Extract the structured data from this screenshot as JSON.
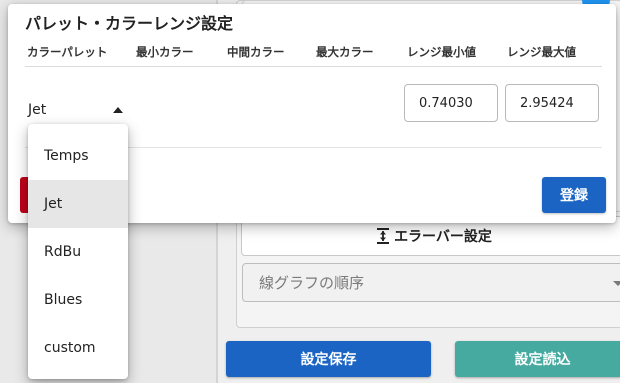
{
  "dialog": {
    "title": "パレット・カラーレンジ設定",
    "headers": [
      "カラーパレット",
      "最小カラー",
      "中間カラー",
      "最大カラー",
      "レンジ最小値",
      "レンジ最大値"
    ],
    "palette_value": "Jet",
    "range_min": "0.74030",
    "range_max": "2.95424",
    "register_label": "登録"
  },
  "dropdown": {
    "options": [
      "Temps",
      "Jet",
      "RdBu",
      "Blues",
      "custom"
    ],
    "selected": "Jet"
  },
  "background": {
    "errorbar_label": "エラーバー設定",
    "order_placeholder": "線グラフの順序",
    "save_label": "設定保存",
    "load_label": "設定読込"
  },
  "colors": {
    "primary_blue": "#1b64c4",
    "teal": "#46aaa0",
    "danger_red": "#c0001a"
  },
  "icons": {
    "errorbar": "vertical-expand-icon",
    "palette_caret": "caret-up-icon",
    "order_caret": "caret-down-icon"
  }
}
